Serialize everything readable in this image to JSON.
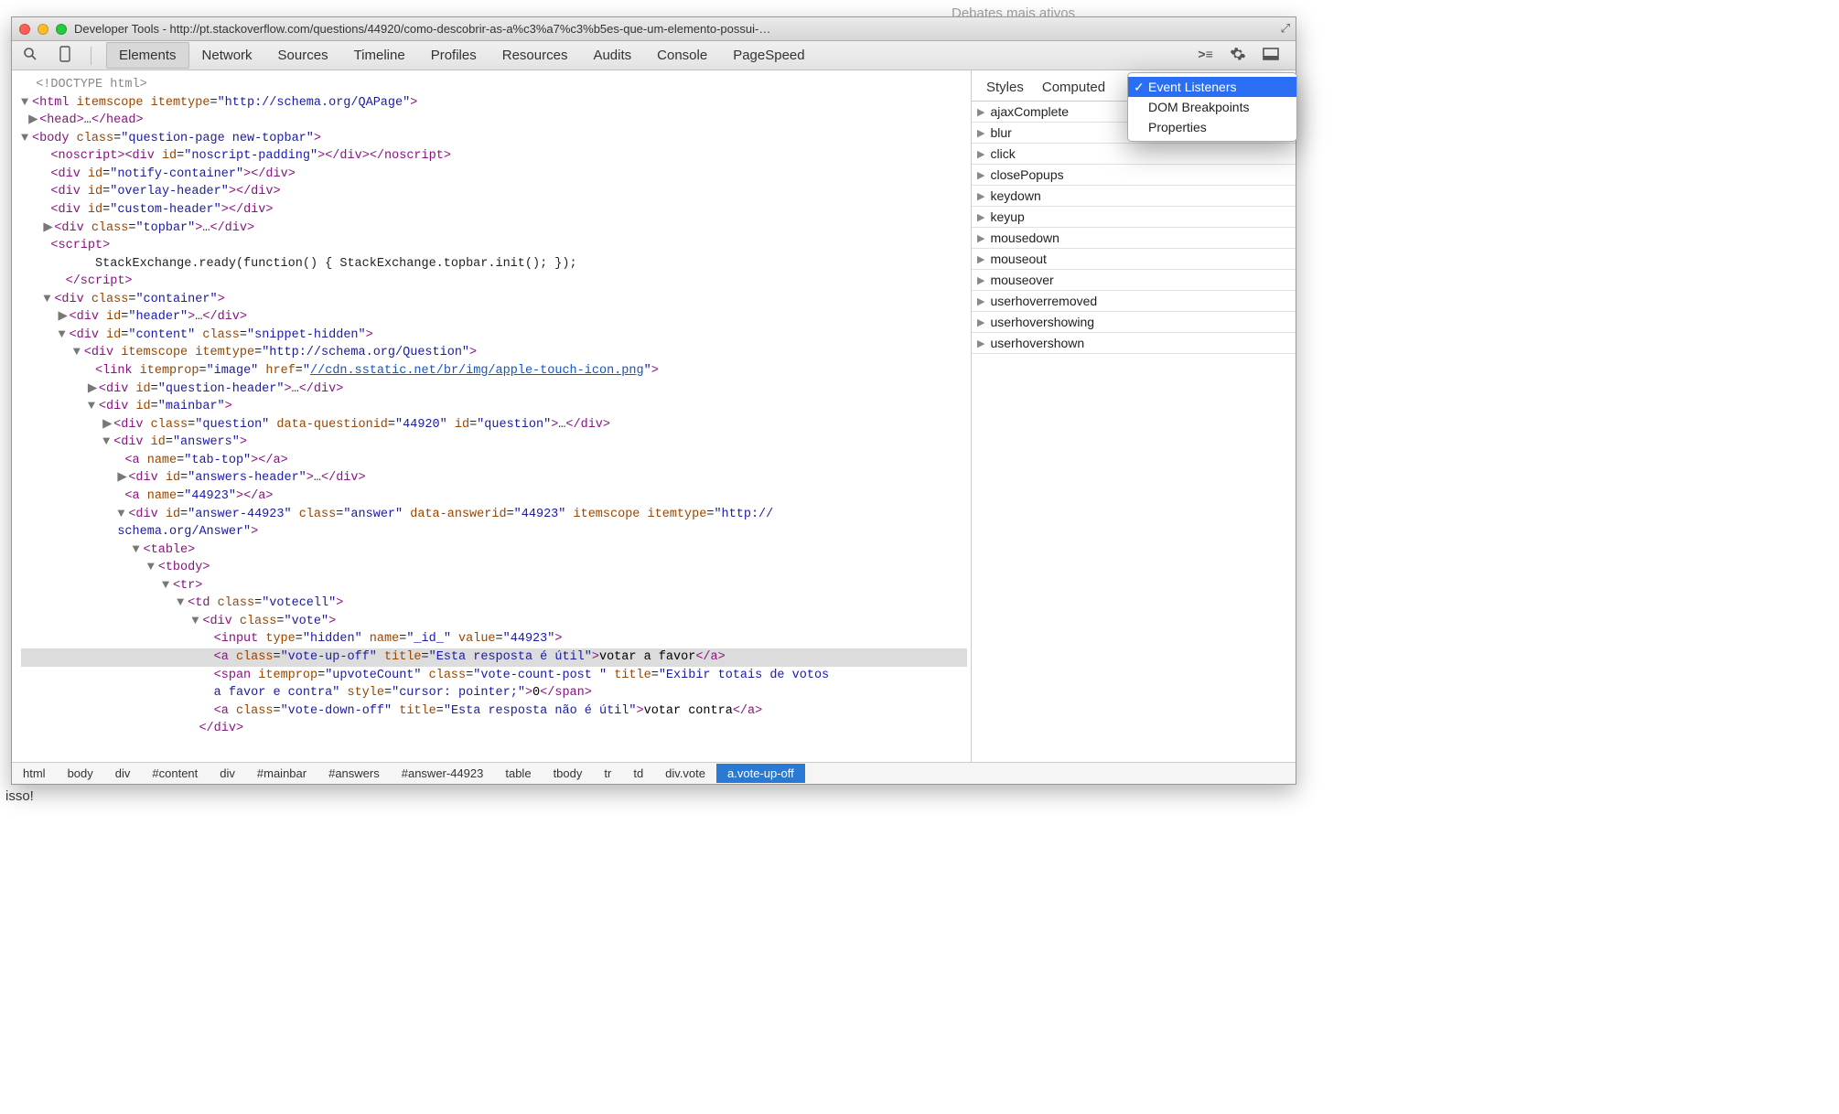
{
  "background_snippets": {
    "top_right": "Debates mais ativos",
    "bottom_left": "isso!"
  },
  "window": {
    "title": "Developer Tools - http://pt.stackoverflow.com/questions/44920/como-descobrir-as-a%c3%a7%c3%b5es-que-um-elemento-possui-…"
  },
  "toolbar": {
    "tabs": [
      "Elements",
      "Network",
      "Sources",
      "Timeline",
      "Profiles",
      "Resources",
      "Audits",
      "Console",
      "PageSpeed"
    ],
    "active_tab": "Elements"
  },
  "side": {
    "tabs": [
      "Styles",
      "Computed"
    ],
    "events": [
      "ajaxComplete",
      "blur",
      "click",
      "closePopups",
      "keydown",
      "keyup",
      "mousedown",
      "mouseout",
      "mouseover",
      "userhoverremoved",
      "userhovershowing",
      "userhovershown"
    ]
  },
  "dropdown": {
    "items": [
      "Event Listeners",
      "DOM Breakpoints",
      "Properties"
    ],
    "selected": "Event Listeners"
  },
  "breadcrumb": [
    "html",
    "body",
    "div",
    "#content",
    "div",
    "#mainbar",
    "#answers",
    "#answer-44923",
    "table",
    "tbody",
    "tr",
    "td",
    "div.vote",
    "a.vote-up-off"
  ],
  "dom": {
    "doctype": "<!DOCTYPE html>",
    "html_attrs": {
      "itemscope": "",
      "itemtype": "http://schema.org/QAPage"
    },
    "head_ellipsis": "…",
    "body_class": "question-page new-topbar",
    "noscript_div_id": "noscript-padding",
    "divs_simple": [
      {
        "id": "notify-container"
      },
      {
        "id": "overlay-header"
      },
      {
        "id": "custom-header"
      }
    ],
    "topbar_class": "topbar",
    "script_text": "StackExchange.ready(function() { StackExchange.topbar.init(); });",
    "container_class": "container",
    "header_id": "header",
    "content": {
      "id": "content",
      "class": "snippet-hidden"
    },
    "question_itemtype": "http://schema.org/Question",
    "link": {
      "itemprop": "image",
      "href": "//cdn.sstatic.net/br/img/apple-touch-icon.png"
    },
    "question_header_id": "question-header",
    "mainbar_id": "mainbar",
    "question_div": {
      "class": "question",
      "data-questionid": "44920",
      "id": "question"
    },
    "answers_id": "answers",
    "a_tab_top_name": "tab-top",
    "answers_header_id": "answers-header",
    "a_44923_name": "44923",
    "answer_div": {
      "id": "answer-44923",
      "class": "answer",
      "data-answerid": "44923",
      "itemtype": "http://schema.org/Answer"
    },
    "votecell_class": "votecell",
    "vote_class": "vote",
    "input_hidden": {
      "type": "hidden",
      "name": "_id_",
      "value": "44923"
    },
    "vote_up": {
      "class": "vote-up-off",
      "title": "Esta resposta é útil",
      "text": "votar a favor"
    },
    "span_upvote": {
      "itemprop": "upvoteCount",
      "class": "vote-count-post ",
      "title": "Exibir totais de votos a favor e contra",
      "style": "cursor: pointer;",
      "text": "0"
    },
    "vote_down": {
      "class": "vote-down-off",
      "title": "Esta resposta não é útil",
      "text": "votar contra"
    }
  }
}
